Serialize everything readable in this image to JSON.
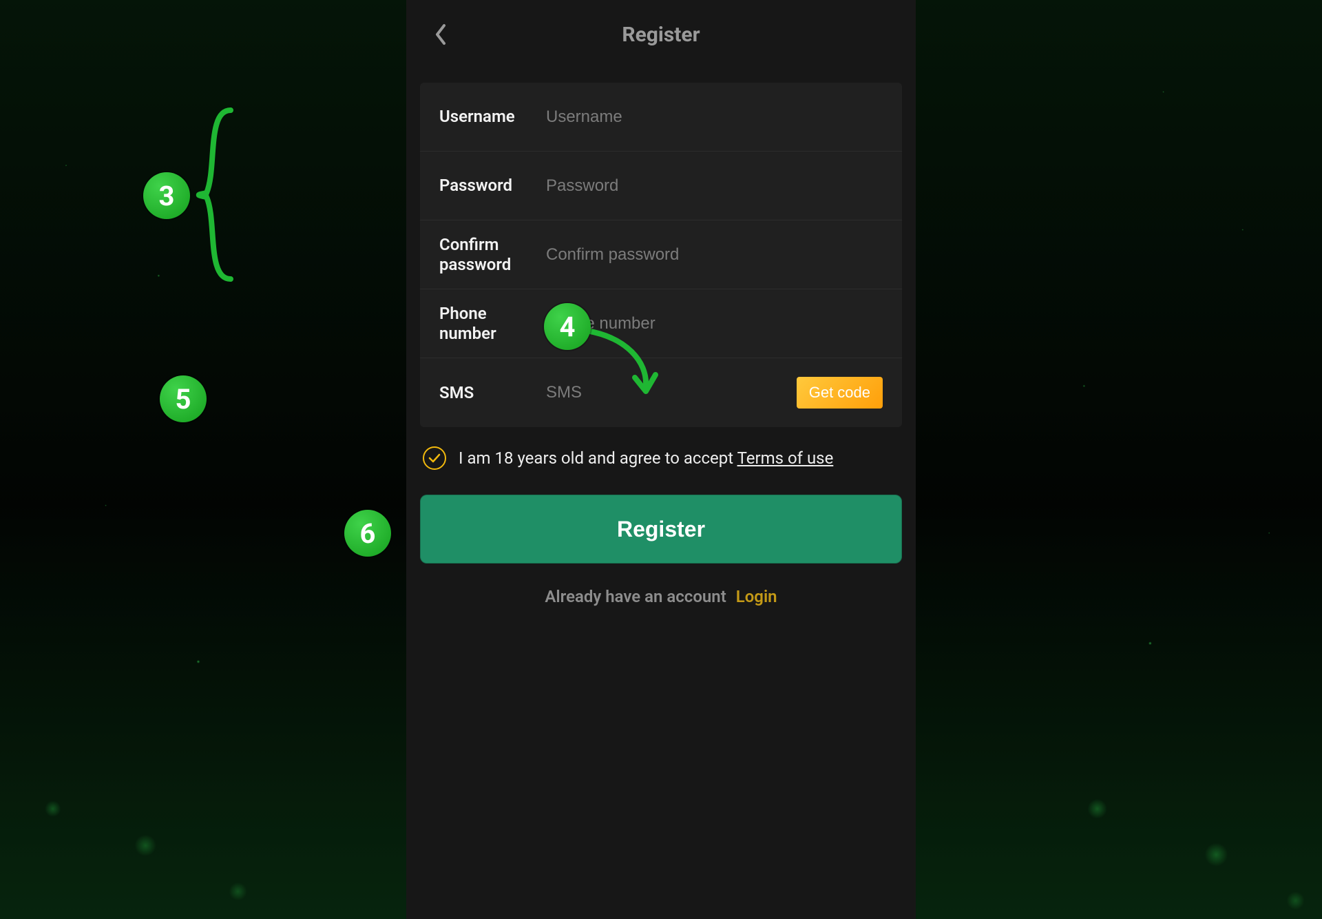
{
  "header": {
    "title": "Register"
  },
  "form": {
    "username": {
      "label": "Username",
      "placeholder": "Username"
    },
    "password": {
      "label": "Password",
      "placeholder": "Password"
    },
    "confirm_password": {
      "label": "Confirm password",
      "placeholder": "Confirm password"
    },
    "phone": {
      "label": "Phone number",
      "placeholder": "Mobile number"
    },
    "sms": {
      "label": "SMS",
      "placeholder": "SMS",
      "get_code": "Get code"
    }
  },
  "terms": {
    "text_prefix": "I am 18 years old and agree to accept ",
    "link": "Terms of use"
  },
  "register_button": "Register",
  "login_line": {
    "text": "Already have an account",
    "link": "Login"
  },
  "annotations": {
    "a3": "3",
    "a4": "4",
    "a5": "5",
    "a6": "6"
  }
}
